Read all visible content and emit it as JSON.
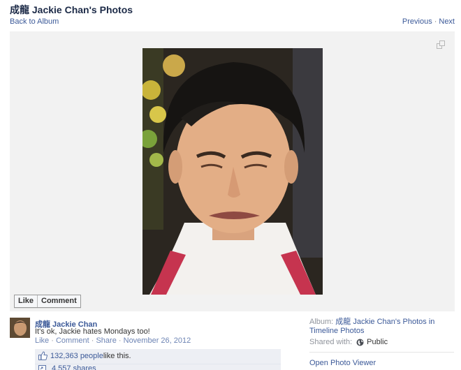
{
  "header": {
    "title": "成龍 Jackie Chan's Photos",
    "back_link": "Back to Album",
    "previous": "Previous",
    "separator": "·",
    "next": "Next"
  },
  "photo": {
    "subject": "portrait photo of a man grimacing, white shirt with red suspenders"
  },
  "actions": {
    "like": "Like",
    "comment": "Comment"
  },
  "post": {
    "author": "成龍 Jackie Chan",
    "caption": "It's ok, Jackie hates Mondays too!",
    "meta_like": "Like",
    "meta_comment": "Comment",
    "meta_share": "Share",
    "meta_sep": "·",
    "date": "November 26, 2012"
  },
  "engagement": {
    "likes_count": "132,363 people",
    "likes_suffix": " like this.",
    "shares": "4,557 shares"
  },
  "sidebar": {
    "album_prefix": "Album: ",
    "album_name": "成龍 Jackie Chan's Photos in Timeline Photos",
    "shared_with_label": "Shared with:",
    "privacy": "Public",
    "open_viewer": "Open Photo Viewer"
  },
  "colors": {
    "link": "#3b5998",
    "stage_bg": "#f2f2f2",
    "likes_bg": "#edeff4"
  }
}
